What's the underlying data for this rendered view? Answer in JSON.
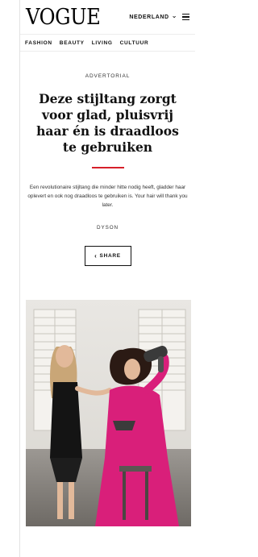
{
  "header": {
    "logo": "VOGUE",
    "region": "NEDERLAND",
    "menu_icon": "hamburger-icon",
    "region_icon": "chevron-down-icon"
  },
  "nav": {
    "items": [
      "FASHION",
      "BEAUTY",
      "LIVING",
      "CULTUUR"
    ]
  },
  "article": {
    "label": "ADVERTORIAL",
    "title": "Deze stijltang zorgt voor glad, pluisvrij haar én is draadloos te gebruiken",
    "lede": "Een revolutionaire stijltang die minder hitte nodig heeft, gladder haar oplevert en ook nog draadloos te gebruiken is. Your hair will thank you later.",
    "byline": "DYSON",
    "share_label": "SHARE",
    "share_icon": "share-icon"
  },
  "colors": {
    "accent": "#d6202a",
    "suit": "#d91f7a"
  }
}
